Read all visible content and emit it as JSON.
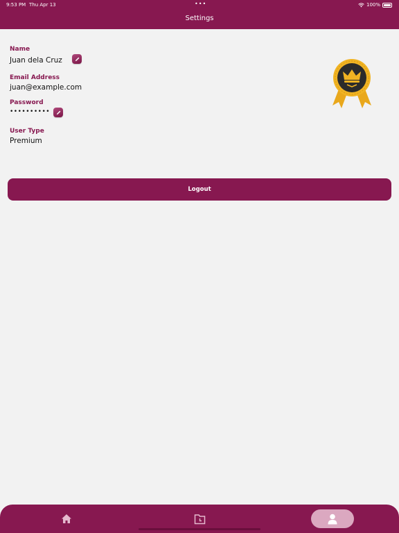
{
  "status_bar": {
    "time": "9:53 PM",
    "date": "Thu Apr 13",
    "dots": "•••",
    "battery": "100%"
  },
  "header": {
    "title": "Settings"
  },
  "profile": {
    "name": {
      "label": "Name",
      "value": "Juan dela Cruz"
    },
    "email": {
      "label": "Email Address",
      "value": "juan@example.com"
    },
    "password": {
      "label": "Password",
      "value": "••••••••••"
    },
    "user_type": {
      "label": "User Type",
      "value": "Premium"
    }
  },
  "badge": {
    "icon": "premium-crown-badge-icon"
  },
  "actions": {
    "logout_label": "Logout"
  },
  "tab_bar": {
    "tabs": [
      {
        "icon": "home-icon",
        "active": false
      },
      {
        "icon": "history-icon",
        "active": false
      },
      {
        "icon": "profile-icon",
        "active": true
      }
    ]
  },
  "colors": {
    "brand": "#871850",
    "background": "#f2f2f2",
    "active_tab": "#dba8c0",
    "badge_gold": "#f0b323",
    "badge_dark": "#2b2b2b"
  }
}
